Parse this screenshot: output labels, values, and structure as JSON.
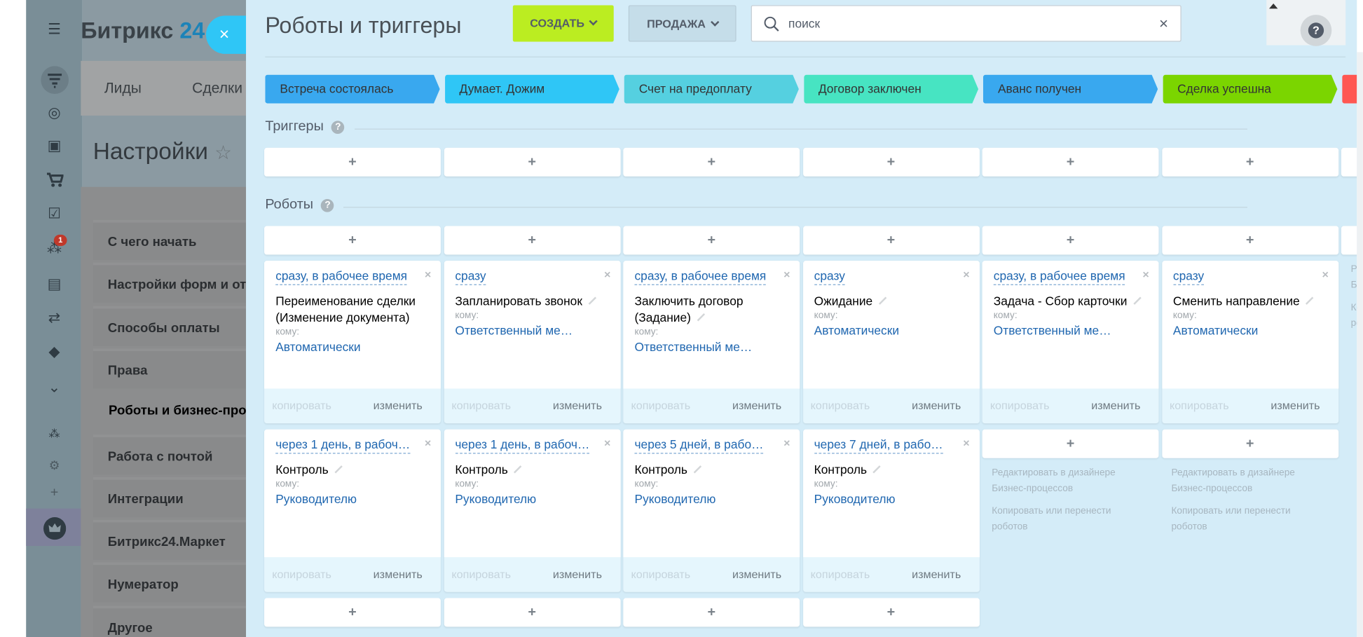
{
  "app": {
    "logo": "Битрикс",
    "logo_num": "24",
    "top_nav": [
      "Лиды",
      "Сделки"
    ],
    "settings_title": "Настройки",
    "notification_badge": "1",
    "settings_menu": [
      {
        "label": "С чего начать",
        "active": false
      },
      {
        "label": "Настройки форм и от",
        "active": false
      },
      {
        "label": "Способы оплаты",
        "active": false
      },
      {
        "label": "Права",
        "active": false
      },
      {
        "label": "Роботы и бизнес-про",
        "active": true
      },
      {
        "label": "Работа с почтой",
        "active": false
      },
      {
        "label": "Интеграции",
        "active": false
      },
      {
        "label": "Битрикс24.Маркет",
        "active": false
      },
      {
        "label": "Нумератор",
        "active": false
      },
      {
        "label": "Другое",
        "active": false
      }
    ]
  },
  "panel": {
    "close_label": "×",
    "title": "Роботы и триггеры",
    "create_label": "СОЗДАТЬ",
    "category_label": "ПРОДАЖА",
    "search_placeholder": "поиск",
    "search_clear": "×",
    "help_label": "?",
    "triggers_label": "Триггеры",
    "robots_label": "Роботы",
    "add_label": "+",
    "copy_label": "копировать",
    "edit_label": "изменить",
    "to_label": "кому:",
    "remove_label": "×",
    "designer_link": "Редактировать в дизайнере Бизнес-процессов",
    "copy_move_link": "Копировать или перенести роботов"
  },
  "stages": [
    {
      "name": "Встреча состоялась",
      "color": "#39a8ef"
    },
    {
      "name": "Думает. Дожим",
      "color": "#2fc6f6"
    },
    {
      "name": "Счет на предоплату",
      "color": "#55d0e0"
    },
    {
      "name": "Договор заключен",
      "color": "#47e4c2"
    },
    {
      "name": "Аванс получен",
      "color": "#39a8ef"
    },
    {
      "name": "Сделка успешна",
      "color": "#7bd500"
    },
    {
      "name": "",
      "color": "#ff5752"
    }
  ],
  "robots": [
    [
      {
        "delay": "сразу, в рабочее время",
        "title": "Переименование сделки (Изменение документа)",
        "pencil": false,
        "to": "Автоматически"
      },
      {
        "delay": "через 1 день, в рабоч…",
        "title": "Контроль",
        "pencil": true,
        "to": "Руководителю"
      }
    ],
    [
      {
        "delay": "сразу",
        "title": "Запланировать звонок",
        "pencil": true,
        "to": "Ответственный ме…"
      },
      {
        "delay": "через 1 день, в рабоч…",
        "title": "Контроль",
        "pencil": true,
        "to": "Руководителю"
      }
    ],
    [
      {
        "delay": "сразу, в рабочее время",
        "title": "Заключить договор (Задание)",
        "pencil": true,
        "to": "Ответственный ме…"
      },
      {
        "delay": "через 5 дней, в рабо…",
        "title": "Контроль",
        "pencil": true,
        "to": "Руководителю"
      }
    ],
    [
      {
        "delay": "сразу",
        "title": "Ожидание",
        "pencil": true,
        "to": "Автоматически"
      },
      {
        "delay": "через 7 дней, в рабо…",
        "title": "Контроль",
        "pencil": true,
        "to": "Руководителю"
      }
    ],
    [
      {
        "delay": "сразу, в рабочее время",
        "title": "Задача - Сбор карточки",
        "pencil": true,
        "to": "Ответственный ме…"
      }
    ],
    [
      {
        "delay": "сразу",
        "title": "Сменить направление",
        "pencil": true,
        "to": "Автоматически"
      }
    ],
    []
  ]
}
